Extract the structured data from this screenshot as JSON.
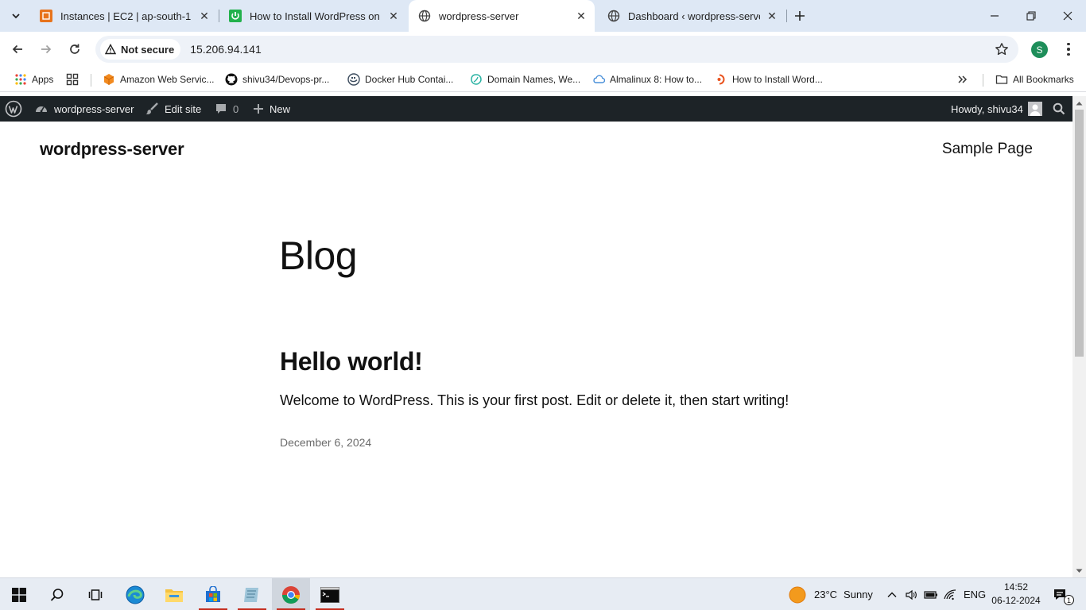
{
  "browser": {
    "tabs": [
      {
        "title": "Instances | EC2 | ap-south-1",
        "icon": "aws-ec2-icon",
        "active": false
      },
      {
        "title": "How to Install WordPress on Lin",
        "icon": "green-power-icon",
        "active": false
      },
      {
        "title": "wordpress-server",
        "icon": "globe-icon",
        "active": true
      },
      {
        "title": "Dashboard ‹ wordpress-server —",
        "icon": "globe-icon",
        "active": false
      }
    ],
    "security_label": "Not secure",
    "url": "15.206.94.141",
    "profile_initial": "S",
    "bookmarks": [
      {
        "label": "Apps"
      },
      {
        "label": "Amazon Web Servic..."
      },
      {
        "label": "shivu34/Devops-pr..."
      },
      {
        "label": "Docker Hub Contai..."
      },
      {
        "label": "Domain Names, We..."
      },
      {
        "label": "Almalinux 8: How to..."
      },
      {
        "label": "How to Install Word..."
      }
    ],
    "all_bookmarks_label": "All Bookmarks"
  },
  "wp_admin_bar": {
    "site_name": "wordpress-server",
    "edit_site": "Edit site",
    "comments_count": "0",
    "new_label": "New",
    "howdy": "Howdy, shivu34"
  },
  "site": {
    "title": "wordpress-server",
    "nav_item": "Sample Page",
    "page_heading": "Blog",
    "post": {
      "title": "Hello world!",
      "excerpt": "Welcome to WordPress. This is your first post. Edit or delete it, then start writing!",
      "date": "December 6, 2024"
    }
  },
  "taskbar": {
    "weather_temp": "23°C",
    "weather_text": "Sunny",
    "language": "ENG",
    "time": "14:52",
    "date": "06-12-2024",
    "notification_count": "1"
  },
  "colors": {
    "tabstrip_bg": "#dee8f5",
    "wp_admin_bar_bg": "#1d2327",
    "profile_green": "#1e8e5a"
  }
}
